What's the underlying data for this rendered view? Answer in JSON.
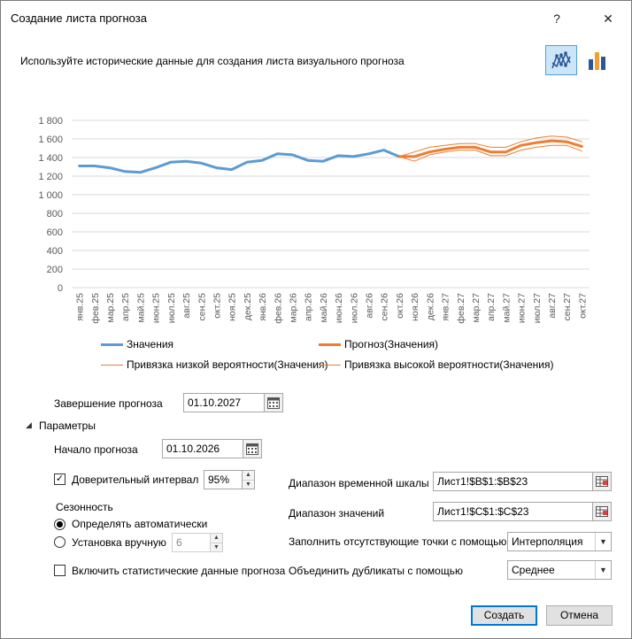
{
  "dialog": {
    "title": "Создание листа прогноза",
    "help": "?",
    "close": "✕",
    "description": "Используйте исторические данные для создания листа визуального прогноза"
  },
  "chart_toggle": {
    "line_chart": "line-chart-icon",
    "column_chart": "column-chart-icon",
    "active": "line"
  },
  "chart_data": {
    "type": "line",
    "categories": [
      "янв.25",
      "фев.25",
      "мар.25",
      "апр.25",
      "май.25",
      "июн.25",
      "июл.25",
      "авг.25",
      "сен.25",
      "окт.25",
      "ноя.25",
      "дек.25",
      "янв.26",
      "фев.26",
      "мар.26",
      "апр.26",
      "май.26",
      "июн.26",
      "июл.26",
      "авг.26",
      "сен.26",
      "окт.26",
      "ноя.26",
      "дек.26",
      "янв.27",
      "фев.27",
      "мар.27",
      "апр.27",
      "май.27",
      "июн.27",
      "июл.27",
      "авг.27",
      "сен.27",
      "окт.27"
    ],
    "yticks": [
      "0",
      "200",
      "400",
      "600",
      "800",
      "1 000",
      "1 200",
      "1 400",
      "1 600",
      "1 800"
    ],
    "ylim": [
      0,
      1800
    ],
    "series": [
      {
        "name": "Значения",
        "color": "#5b9bd5",
        "start": 0,
        "values": [
          1310,
          1310,
          1290,
          1250,
          1240,
          1290,
          1350,
          1360,
          1340,
          1290,
          1270,
          1350,
          1370,
          1440,
          1430,
          1370,
          1360,
          1420,
          1410,
          1440,
          1480,
          1410
        ]
      },
      {
        "name": "Прогноз(Значения)",
        "color": "#ed7d31",
        "start": 21,
        "values": [
          1410,
          1410,
          1460,
          1490,
          1510,
          1510,
          1460,
          1460,
          1530,
          1560,
          1580,
          1570,
          1520
        ]
      },
      {
        "name": "Привязка низкой вероятности(Значения)",
        "color": "#ed7d31",
        "start": 21,
        "values": [
          1410,
          1360,
          1430,
          1460,
          1480,
          1480,
          1420,
          1420,
          1480,
          1510,
          1530,
          1530,
          1470
        ]
      },
      {
        "name": "Привязка высокой вероятности(Значения)",
        "color": "#ed7d31",
        "start": 21,
        "values": [
          1410,
          1460,
          1510,
          1530,
          1550,
          1550,
          1510,
          1510,
          1570,
          1610,
          1630,
          1620,
          1570
        ]
      }
    ],
    "legend_placement": "bottom",
    "grid": true
  },
  "form": {
    "end_label": "Завершение прогноза",
    "end_value": "01.10.2027",
    "params_label": "Параметры",
    "start_label": "Начало прогноза",
    "start_value": "01.10.2026",
    "confidence_label": "Доверительный интервал",
    "confidence_value": "95%",
    "seasonality_label": "Сезонность",
    "season_auto": "Определять автоматически",
    "season_manual": "Установка вручную",
    "season_value": "6",
    "stats_label": "Включить статистические данные прогноза",
    "timeline_label": "Диапазон временной шкалы",
    "timeline_value": "Лист1!$B$1:$B$23",
    "values_label": "Диапазон значений",
    "values_value": "Лист1!$C$1:$C$23",
    "fill_label": "Заполнить отсутствующие точки с помощью",
    "fill_value": "Интерполяция",
    "dup_label": "Объединить дубликаты с помощью",
    "dup_value": "Среднее",
    "create_btn": "Создать",
    "cancel_btn": "Отмена"
  }
}
